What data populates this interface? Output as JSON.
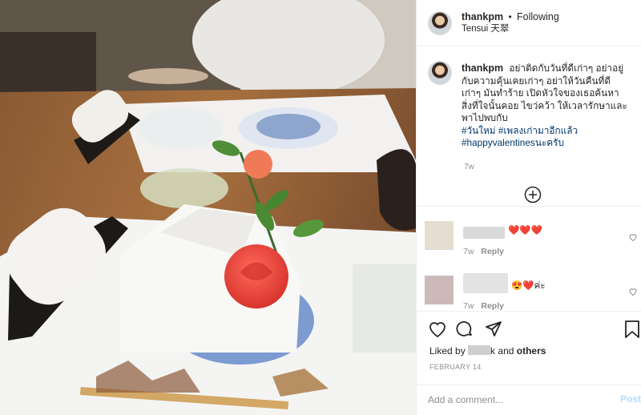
{
  "post": {
    "username": "thankpm",
    "follow_status": "Following",
    "separator": "•",
    "location": "Tensui 天翠"
  },
  "caption": {
    "username": "thankpm",
    "text": "อย่าติดกับวันที่ดีเก่าๆ อย่าอยู่กับความคุ้นเคยเก่าๆ อย่าให้วันคืนที่ดีเก่าๆ มันทำร้าย เปิดหัวใจของเธอค้นหา สิ่งที่ใจนั้นคอย ไขว่คว้า ให้เวลารักษาและพาไปพบกับ",
    "hashtag1": "#วันใหม่",
    "hashtag2": "#เพลงเก่ามาอีกแล้ว",
    "hashtag3": "#happyvalentinesนะครับ",
    "time": "7w"
  },
  "comments": [
    {
      "text": "❤️❤️❤️",
      "time": "7w",
      "reply": "Reply"
    },
    {
      "text": "😍❤️ค่ะ",
      "time": "7w",
      "reply": "Reply"
    }
  ],
  "actions": {
    "liked_by_prefix": "Liked by",
    "liked_by_suffix": "k",
    "and": "and",
    "others": "others",
    "date": "FEBRUARY 14"
  },
  "add_comment": {
    "placeholder": "Add a comment...",
    "post_label": "Post"
  },
  "icons": {
    "load_more": "plus-circle-icon",
    "like": "heart-icon",
    "comment": "comment-icon",
    "share": "share-icon",
    "save": "bookmark-icon"
  },
  "colors": {
    "link": "#00376b",
    "muted": "#8e8e8e",
    "post_disabled": "#b3dbff",
    "heart_red": "#ed4956"
  }
}
